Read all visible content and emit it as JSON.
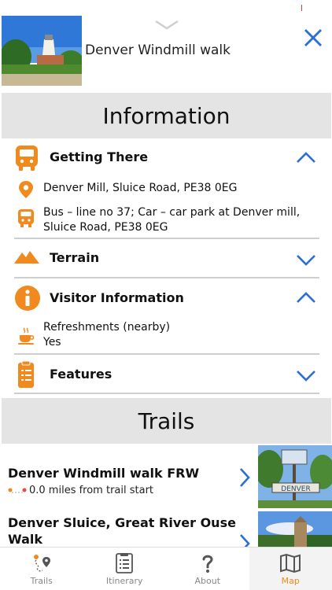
{
  "header": {
    "title": "Denver Windmill walk"
  },
  "information": {
    "heading": "Information",
    "getting_there": {
      "label": "Getting There",
      "address": "Denver Mill, Sluice Road, PE38 0EG",
      "transport": "Bus – line no 37; Car – car park at Denver mill, Sluice Road, PE38 0EG"
    },
    "terrain": {
      "label": "Terrain"
    },
    "visitor": {
      "label": "Visitor Information",
      "refreshments_label": "Refreshments (nearby)",
      "refreshments_value": "Yes"
    },
    "features": {
      "label": "Features"
    }
  },
  "trails": {
    "heading": "Trails",
    "items": [
      {
        "name": "Denver Windmill walk FRW",
        "distance": "0.0 miles from trail start"
      },
      {
        "name": "Denver Sluice, Great River Ouse Walk"
      }
    ]
  },
  "tabbar": {
    "tabs": [
      {
        "label": "Trails"
      },
      {
        "label": "Itinerary"
      },
      {
        "label": "About"
      },
      {
        "label": "Map"
      }
    ]
  },
  "colors": {
    "accent": "#f08a1e",
    "link": "#2a6fd6",
    "section_bg": "#e4e4e4"
  }
}
